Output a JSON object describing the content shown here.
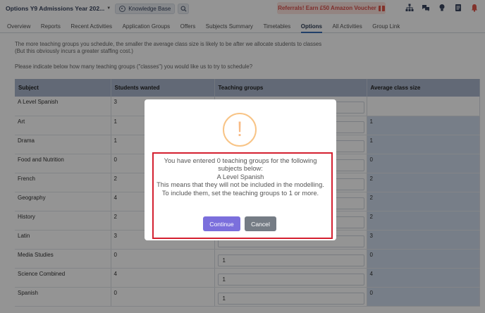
{
  "header": {
    "app_title": "Options Y9 Admissions Year 202...",
    "kb_label": "Knowledge Base",
    "referral_label": "Referrals! Earn £50 Amazon Voucher",
    "icons": [
      "org-chart-icon",
      "chat-icon",
      "lightbulb-icon",
      "document-icon",
      "bell-icon"
    ]
  },
  "tabs": [
    {
      "label": "Overview"
    },
    {
      "label": "Reports"
    },
    {
      "label": "Recent Activities"
    },
    {
      "label": "Application Groups"
    },
    {
      "label": "Offers"
    },
    {
      "label": "Subjects Summary"
    },
    {
      "label": "Timetables"
    },
    {
      "label": "Options",
      "active": true
    },
    {
      "label": "All Activities"
    },
    {
      "label": "Group Link"
    }
  ],
  "intro": {
    "line1": "The more teaching groups you schedule, the smaller the average class size is likely to be after we allocate students to classes",
    "line2": "(But this obviously incurs a greater staffing cost.)",
    "prompt": "Please indicate below how many teaching groups (\"classes\") you would like us to try to schedule?"
  },
  "table": {
    "headers": {
      "subject": "Subject",
      "students": "Students wanted",
      "groups": "Teaching groups",
      "avg": "Average class size"
    },
    "rows": [
      {
        "subject": "A Level Spanish",
        "students": "3",
        "groups": "",
        "avg": ""
      },
      {
        "subject": "Art",
        "students": "1",
        "groups": "",
        "avg": "1"
      },
      {
        "subject": "Drama",
        "students": "1",
        "groups": "",
        "avg": "1"
      },
      {
        "subject": "Food and Nutrition",
        "students": "0",
        "groups": "",
        "avg": "0"
      },
      {
        "subject": "French",
        "students": "2",
        "groups": "",
        "avg": "2"
      },
      {
        "subject": "Geography",
        "students": "4",
        "groups": "",
        "avg": "2"
      },
      {
        "subject": "History",
        "students": "2",
        "groups": "",
        "avg": "2"
      },
      {
        "subject": "Latin",
        "students": "3",
        "groups": "",
        "avg": "3"
      },
      {
        "subject": "Media Studies",
        "students": "0",
        "groups": "1",
        "avg": "0"
      },
      {
        "subject": "Science Combined",
        "students": "4",
        "groups": "1",
        "avg": "4"
      },
      {
        "subject": "Spanish",
        "students": "0",
        "groups": "1",
        "avg": "0"
      }
    ]
  },
  "modal": {
    "icon": "!",
    "line1": "You have entered 0 teaching groups for the following subjects below:",
    "subject": "A Level Spanish",
    "line2": "This means that they will not be included in the modelling. To include them, set the teaching groups to 1 or more.",
    "continue_label": "Continue",
    "cancel_label": "Cancel"
  },
  "colors": {
    "accent": "#7b6fdc",
    "cancel": "#757c85",
    "highlight": "#d42030",
    "warning": "#f8bb86",
    "table_header": "#a9b6cc",
    "avg_cell": "#cdd9ea"
  }
}
